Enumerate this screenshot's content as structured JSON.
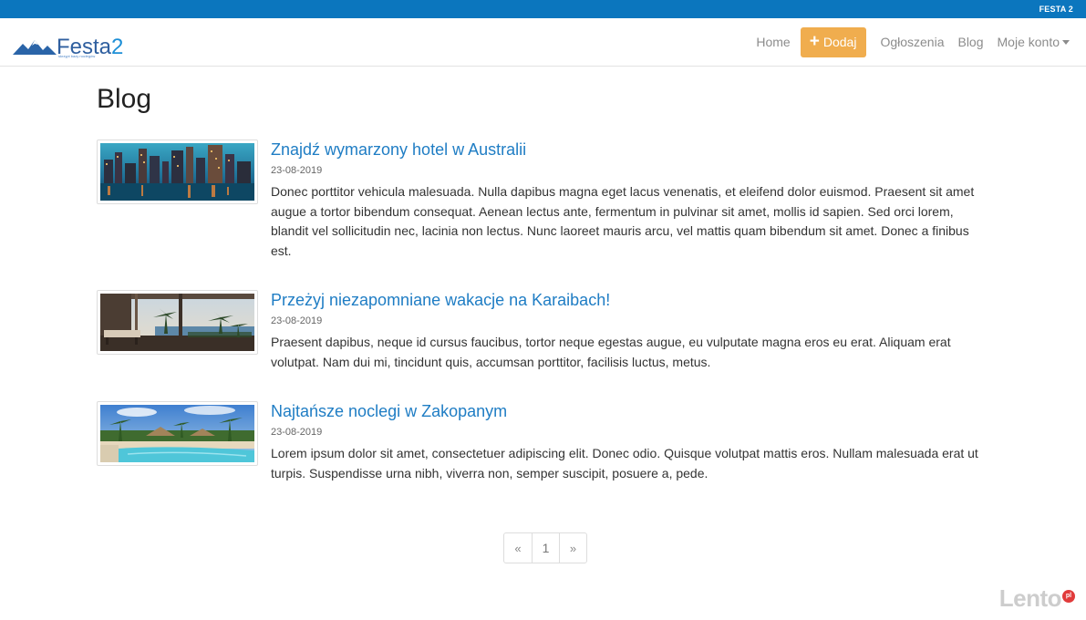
{
  "topbar": {
    "label": "FESTA 2"
  },
  "brand": {
    "name_main": "Festa",
    "name_suffix": "2",
    "tagline": "skrzypt bazy noclegów",
    "logo_icon": "mountains-icon"
  },
  "nav": {
    "home": "Home",
    "add": "Dodaj",
    "add_icon": "plus-icon",
    "listings": "Ogłoszenia",
    "blog": "Blog",
    "account": "Moje konto"
  },
  "page": {
    "title": "Blog"
  },
  "posts": [
    {
      "title": "Znajdź wymarzony hotel w Australii",
      "date": "23-08-2019",
      "excerpt": "Donec porttitor vehicula malesuada. Nulla dapibus magna eget lacus venenatis, et eleifend dolor euismod. Praesent sit amet augue a tortor bibendum consequat. Aenean lectus ante, fermentum in pulvinar sit amet, mollis id sapien. Sed orci lorem, blandit vel sollicitudin nec, lacinia non lectus. Nunc laoreet mauris arcu, vel mattis quam bibendum sit amet. Donec a finibus est."
    },
    {
      "title": "Przeżyj niezapomniane wakacje na Karaibach!",
      "date": "23-08-2019",
      "excerpt": "Praesent dapibus, neque id cursus faucibus, tortor neque egestas augue, eu vulputate magna eros eu erat. Aliquam erat volutpat. Nam dui mi, tincidunt quis, accumsan porttitor, facilisis luctus, metus."
    },
    {
      "title": "Najtańsze noclegi w Zakopanym",
      "date": "23-08-2019",
      "excerpt": "Lorem ipsum dolor sit amet, consectetuer adipiscing elit. Donec odio. Quisque volutpat mattis eros. Nullam malesuada erat ut turpis. Suspendisse urna nibh, viverra non, semper suscipit, posuere a, pede."
    }
  ],
  "pagination": {
    "prev": "«",
    "current": "1",
    "next": "»"
  },
  "watermark": {
    "text": "Lento",
    "badge": "pl"
  },
  "colors": {
    "topbar": "#0b76be",
    "accent": "#f0ad4e",
    "link": "#1f7dc4"
  }
}
